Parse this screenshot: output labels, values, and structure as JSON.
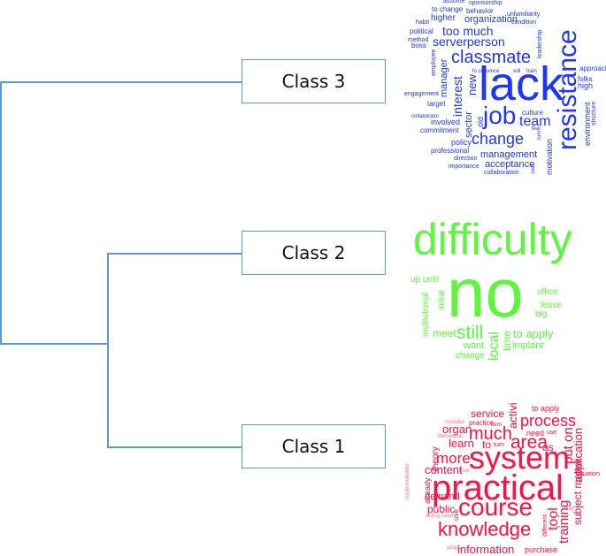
{
  "colors": {
    "connector": "#5b9bd5",
    "class3_cloud": "#1f35ff",
    "class2_cloud": "#5df53e",
    "class1_cloud": "#ff0f43"
  },
  "dendrogram": {
    "structure": "Class 3 joins (Class 2 + Class 1) at root; Class 2 and Class 1 join first",
    "nodes": [
      {
        "id": "class3",
        "label": "Class 3"
      },
      {
        "id": "class2",
        "label": "Class 2"
      },
      {
        "id": "class1",
        "label": "Class 1"
      }
    ]
  },
  "clouds": {
    "class3": {
      "words": [
        "assume",
        "sponsorship",
        "to change",
        "behavior",
        "unfamiliarity",
        "habit",
        "higher",
        "organization",
        "condition",
        "political",
        "too much",
        "method",
        "serverperson",
        "boss",
        "leadership",
        "classmate",
        "employee",
        "to convince",
        "will",
        "train",
        "approach",
        "manager",
        "interest",
        "new",
        "lack",
        "folks",
        "high",
        "engagement",
        "resistance",
        "target",
        "culture",
        "environment",
        "structure",
        "collaborator",
        "job",
        "team",
        "involved",
        "sector",
        "old",
        "fear",
        "commitment",
        "rum",
        "policy",
        "change",
        "professional",
        "motivation",
        "direction",
        "management",
        "importance",
        "acceptance",
        "ract",
        "collaboration"
      ]
    },
    "class2": {
      "words": [
        "difficulty",
        "up until",
        "no",
        "institutional",
        "initial",
        "office",
        "leave",
        "big",
        "meet",
        "still",
        "local",
        "time",
        "to apply",
        "want",
        "implant",
        "change"
      ]
    },
    "class1": {
      "words": [
        "to apply",
        "service",
        "activi",
        "process",
        "practice",
        "form",
        "organ",
        "much",
        "need",
        "use",
        "learn",
        "to",
        "turn",
        "area",
        "as",
        "put on",
        "theory",
        "more",
        "system",
        "application",
        "content",
        "ever",
        "practical",
        "already",
        "situation",
        "subject matter",
        "demand",
        "course",
        "tool",
        "public",
        "use",
        "training",
        "knowledge",
        "different",
        "information",
        "purchase",
        "adapt",
        "theoretical",
        "complex",
        "day",
        "implementation",
        "acting need"
      ]
    }
  }
}
